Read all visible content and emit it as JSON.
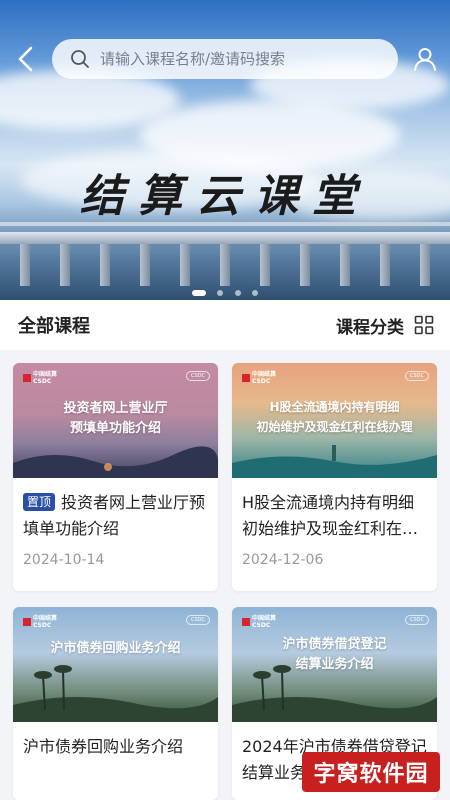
{
  "header": {
    "search_placeholder": "请输入课程名称/邀请码搜索",
    "banner_title": "结算云课堂",
    "banner_dots": 4,
    "banner_active_dot": 0
  },
  "section": {
    "title": "全部课程",
    "category_label": "课程分类"
  },
  "courses": [
    {
      "thumb_title": "投资者网上营业厅\n预填单功能介绍",
      "badge": "置顶",
      "title": "投资者网上营业厅预填单功能介绍",
      "date": "2024-10-14"
    },
    {
      "thumb_title": "H股全流通境内持有明细\n初始维护及现金红利在线办理",
      "badge": "",
      "title": "H股全流通境内持有明细初始维护及现金红利在…",
      "date": "2024-12-06"
    },
    {
      "thumb_title": "沪市债券回购业务介绍",
      "badge": "",
      "title": "沪市债券回购业务介绍",
      "date": ""
    },
    {
      "thumb_title": "沪市债券借贷登记\n结算业务介绍",
      "badge": "",
      "title": "2024年沪市债券借贷登记结算业务介绍",
      "date": ""
    }
  ],
  "thumb_logo": "中国结算\nCSDC",
  "watermark": "字窝软件园",
  "colors": {
    "badge": "#2a4fa7",
    "watermark": "#c8201f"
  }
}
